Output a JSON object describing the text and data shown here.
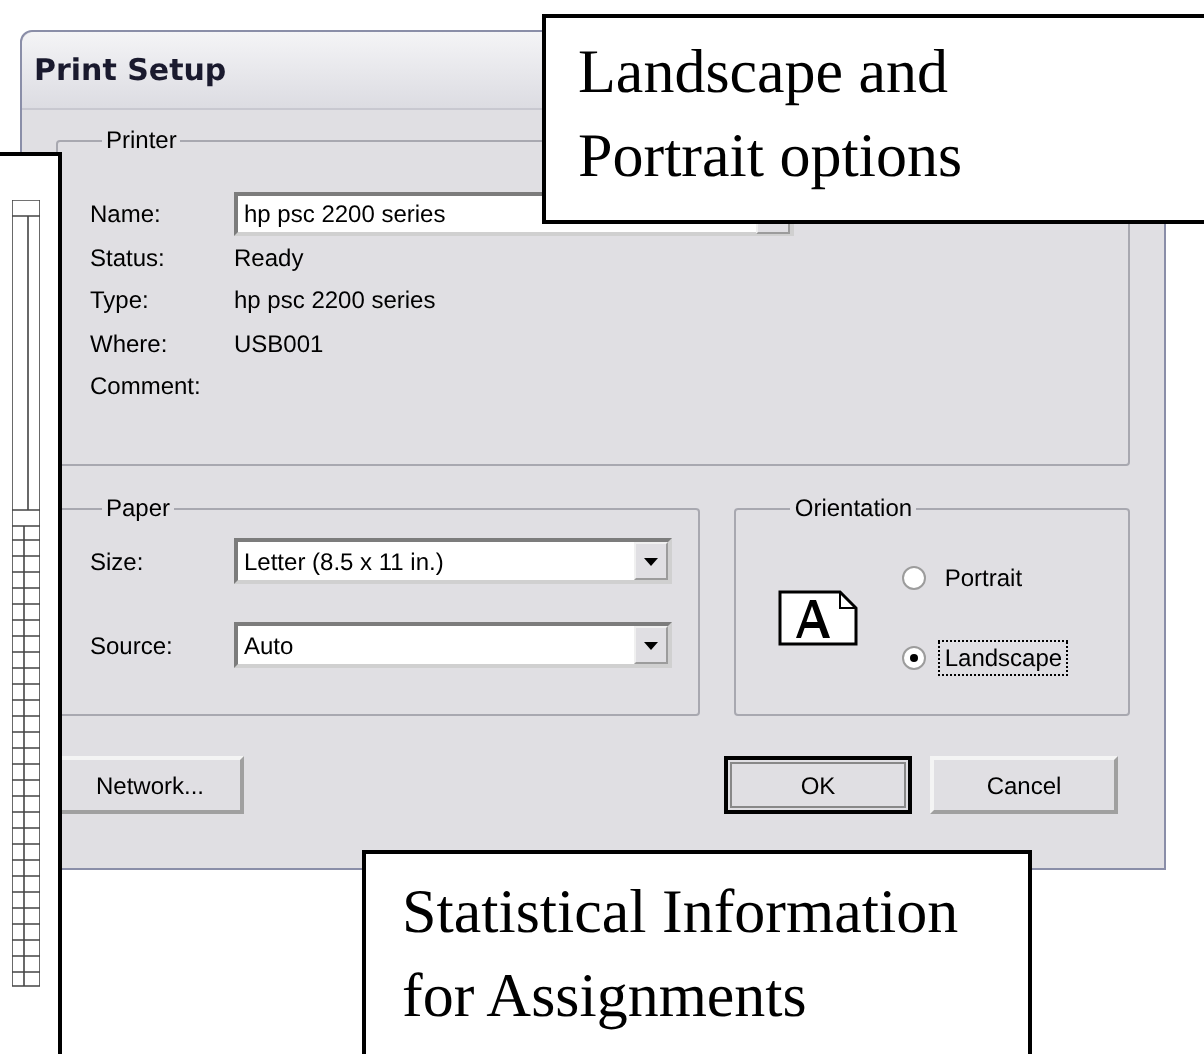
{
  "dialog": {
    "title": "Print Setup",
    "printer": {
      "label": "Printer",
      "name_label": "Name:",
      "name_value": "hp psc 2200 series",
      "info": [
        {
          "label": "Status:",
          "value": "Ready"
        },
        {
          "label": "Type:",
          "value": "hp psc 2200 series"
        },
        {
          "label": "Where:",
          "value": "USB001"
        },
        {
          "label": "Comment:"
        }
      ]
    },
    "paper": {
      "label": "Paper",
      "fields": [
        {
          "label": "Size:",
          "value": "Letter (8.5 x 11 in.)"
        },
        {
          "label": "Source:",
          "value": "Auto"
        }
      ]
    },
    "orientation": {
      "label": "Orientation",
      "options": [
        {
          "label": "Portrait",
          "selected": false,
          "focused": false
        },
        {
          "label": "Landscape",
          "selected": true,
          "focused": true
        }
      ]
    },
    "buttons": [
      {
        "label": "Network...",
        "default": false
      },
      {
        "label": "OK",
        "default": true
      },
      {
        "label": "Cancel",
        "default": false
      }
    ]
  },
  "callouts": [
    {
      "text": "Landscape and Portrait options"
    },
    {
      "text": "Statistical Information for Assignments"
    }
  ]
}
